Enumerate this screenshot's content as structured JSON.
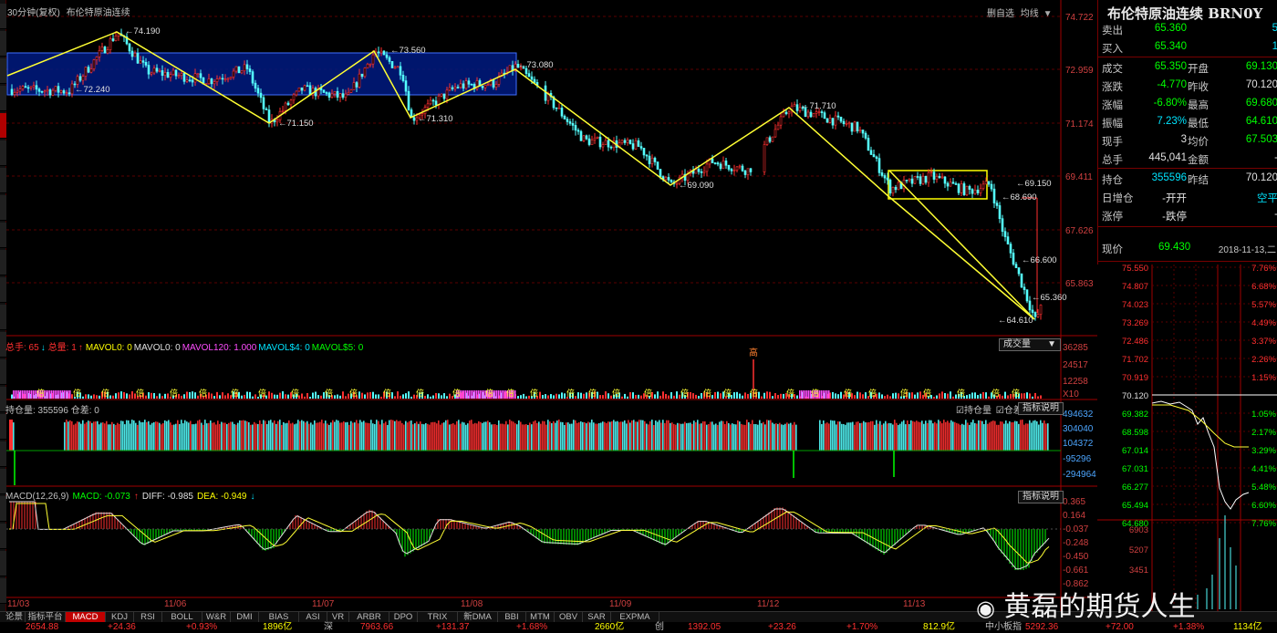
{
  "window": {
    "period_label": "30分钟(复权)",
    "instrument_label": "布伦特原油连续",
    "toolbar_btns": [
      "删自选",
      "均线"
    ]
  },
  "price_axis": [
    "74.722",
    "72.959",
    "71.174",
    "69.411",
    "67.626",
    "65.863"
  ],
  "annotations": [
    "74.190",
    "72.240",
    "73.560",
    "71.150",
    "71.310",
    "73.080",
    "69.090",
    "71.710",
    "69.150",
    "68.690",
    "66.600",
    "65.360",
    "64.610"
  ],
  "volume_panel": {
    "indicators": [
      {
        "label": "总手: 65",
        "color": "#ff3030"
      },
      {
        "label": "↓",
        "color": "#00e5ff"
      },
      {
        "label": "总量: 1",
        "color": "#ff3030"
      },
      {
        "label": "↑",
        "color": "#ff3030"
      },
      {
        "label": "MAVOL0: 0",
        "color": "#ffff00"
      },
      {
        "label": "MAVOL0: 0",
        "color": "#e0e0e0"
      },
      {
        "label": "MAVOL120: 1.000",
        "color": "#ff4dff"
      },
      {
        "label": "MAVOL$4: 0",
        "color": "#00e5ff"
      },
      {
        "label": "MAVOL$5: 0",
        "color": "#00ff00"
      }
    ],
    "dropdown": "成交量",
    "axis": [
      "36285",
      "24517",
      "12258",
      "X10"
    ],
    "marker": "高"
  },
  "oi_panel": {
    "label": "持仓量: 355596 仓差: 0",
    "check1": "持仓量",
    "check2": "仓差",
    "help": "指标说明",
    "axis": [
      "494632",
      "304040",
      "104372",
      "-95296",
      "-294964"
    ]
  },
  "macd_panel": {
    "indicators": [
      {
        "label": "MACD(12,26,9)",
        "color": "#c0c0c0"
      },
      {
        "label": "MACD: -0.073",
        "color": "#00ff00"
      },
      {
        "label": "↑",
        "color": "#ff3030"
      },
      {
        "label": "DIFF: -0.985",
        "color": "#e0e0e0"
      },
      {
        "label": "DEA: -0.949",
        "color": "#ffff00"
      },
      {
        "label": "↓",
        "color": "#00e5ff"
      }
    ],
    "help": "指标说明",
    "axis": [
      "0.365",
      "0.164",
      "-0.037",
      "-0.248",
      "-0.450",
      "-0.661",
      "-0.862"
    ]
  },
  "dates": [
    "11/03",
    "11/06",
    "11/07",
    "11/08",
    "11/09",
    "11/12",
    "11/13"
  ],
  "info_panel": {
    "title": "布伦特原油连续 BRN0Y",
    "rows": [
      {
        "l": "卖出",
        "v": "65.360",
        "vc": "#00ff00",
        "l2": "",
        "v2": "5",
        "v2c": "#00e5ff"
      },
      {
        "l": "买入",
        "v": "65.340",
        "vc": "#00ff00",
        "l2": "",
        "v2": "1",
        "v2c": "#00e5ff"
      },
      {
        "l": "成交",
        "v": "65.350",
        "vc": "#00ff00",
        "l2": "开盘",
        "v2": "69.130",
        "v2c": "#00ff00"
      },
      {
        "l": "涨跌",
        "v": "-4.770",
        "vc": "#00ff00",
        "l2": "昨收",
        "v2": "70.120",
        "v2c": "#e0e0e0"
      },
      {
        "l": "涨幅",
        "v": "-6.80%",
        "vc": "#00ff00",
        "l2": "最高",
        "v2": "69.680",
        "v2c": "#00ff00"
      },
      {
        "l": "振幅",
        "v": "7.23%",
        "vc": "#00e5ff",
        "l2": "最低",
        "v2": "64.610",
        "v2c": "#00ff00"
      },
      {
        "l": "现手",
        "v": "3",
        "vc": "#e0e0e0",
        "l2": "均价",
        "v2": "67.503",
        "v2c": "#00ff00"
      },
      {
        "l": "总手",
        "v": "445,041",
        "vc": "#e0e0e0",
        "l2": "金额",
        "v2": "-",
        "v2c": "#e0e0e0"
      },
      {
        "l": "持仓",
        "v": "355596",
        "vc": "#00e5ff",
        "l2": "昨结",
        "v2": "70.120",
        "v2c": "#e0e0e0"
      },
      {
        "l": "日增仓",
        "v": "-开开",
        "vc": "#e0e0e0",
        "l2": "",
        "v2": "空平",
        "v2c": "#00e5ff"
      },
      {
        "l": "涨停",
        "v": "-跌停",
        "vc": "#e0e0e0",
        "l2": "",
        "v2": "-",
        "v2c": "#e0e0e0"
      }
    ],
    "now_label": "现价",
    "now_value": "69.430",
    "now_date": "2018-11-13,二"
  },
  "mini_chart": {
    "left_axis": [
      "75.550",
      "74.807",
      "74.023",
      "73.269",
      "72.486",
      "71.702",
      "70.919",
      "70.120",
      "69.382",
      "68.598",
      "67.014",
      "67.031",
      "66.277",
      "65.494",
      "64.680"
    ],
    "right_axis": [
      "7.76%",
      "6.68%",
      "5.57%",
      "4.49%",
      "3.37%",
      "2.26%",
      "1.15%",
      "",
      "1.05%",
      "2.17%",
      "3.29%",
      "4.41%",
      "5.48%",
      "6.60%",
      "7.76%"
    ],
    "vol_axis": [
      "6903",
      "5207",
      "3451"
    ]
  },
  "tabs": [
    "论景",
    "指标平台",
    "MACD",
    "KDJ",
    "RSI",
    "BOLL",
    "W&R",
    "DMI",
    "BIAS",
    "ASI",
    "VR",
    "ARBR",
    "DPO",
    "TRIX",
    "新DMA",
    "BBI",
    "MTM",
    "OBV",
    "SAR",
    "EXPMA"
  ],
  "active_tab": "MACD",
  "status_bar": [
    {
      "t": "2654.88",
      "c": "#ff3030"
    },
    {
      "t": "+24.36",
      "c": "#ff3030"
    },
    {
      "t": "+0.93%",
      "c": "#ff3030"
    },
    {
      "t": "1896亿",
      "c": "#ffff00"
    },
    {
      "t": "深",
      "c": "#c0c0c0"
    },
    {
      "t": "7963.66",
      "c": "#ff3030"
    },
    {
      "t": "+131.37",
      "c": "#ff3030"
    },
    {
      "t": "+1.68%",
      "c": "#ff3030"
    },
    {
      "t": "2660亿",
      "c": "#ffff00"
    },
    {
      "t": "创",
      "c": "#c0c0c0"
    },
    {
      "t": "1392.05",
      "c": "#ff3030"
    },
    {
      "t": "+23.26",
      "c": "#ff3030"
    },
    {
      "t": "+1.70%",
      "c": "#ff3030"
    },
    {
      "t": "812.9亿",
      "c": "#ffff00"
    },
    {
      "t": "中小板指",
      "c": "#c0c0c0"
    },
    {
      "t": "5292.36",
      "c": "#ff3030"
    },
    {
      "t": "+72.00",
      "c": "#ff3030"
    },
    {
      "t": "+1.38%",
      "c": "#ff3030"
    },
    {
      "t": "1134亿",
      "c": "#ffff00"
    }
  ],
  "watermark": "黄磊的期货人生"
}
